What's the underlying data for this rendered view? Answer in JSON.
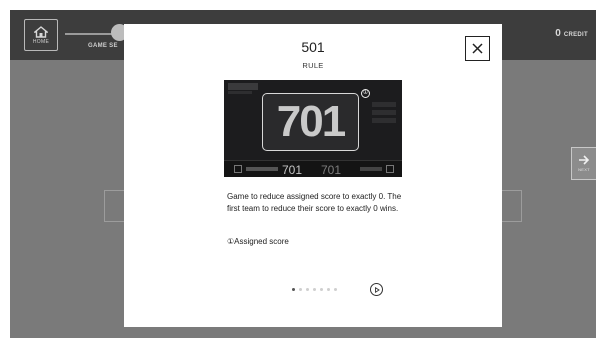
{
  "topbar": {
    "home_label": "HOME",
    "step_label": "GAME SE",
    "credit_value": "0",
    "credit_label": "CREDIT"
  },
  "side": {
    "next_label": "NEXT"
  },
  "modal": {
    "title": "501",
    "subtitle": "RULE",
    "description": "Game to reduce assigned score to exactly 0. The first team to reduce their score to exactly 0 wins.",
    "note": "①Assigned score",
    "pager": {
      "total": 7,
      "active": 0
    }
  },
  "preview": {
    "main_score": "701",
    "badge": "①",
    "player1_score": "701",
    "player2_score": "701"
  },
  "icons": {
    "home": "home-icon",
    "close": "close-icon",
    "next": "arrow-right-icon",
    "play": "play-icon"
  },
  "colors": {
    "topbar": "#3d3d3d",
    "overlay": "#7a7a7a",
    "modal": "#ffffff"
  }
}
